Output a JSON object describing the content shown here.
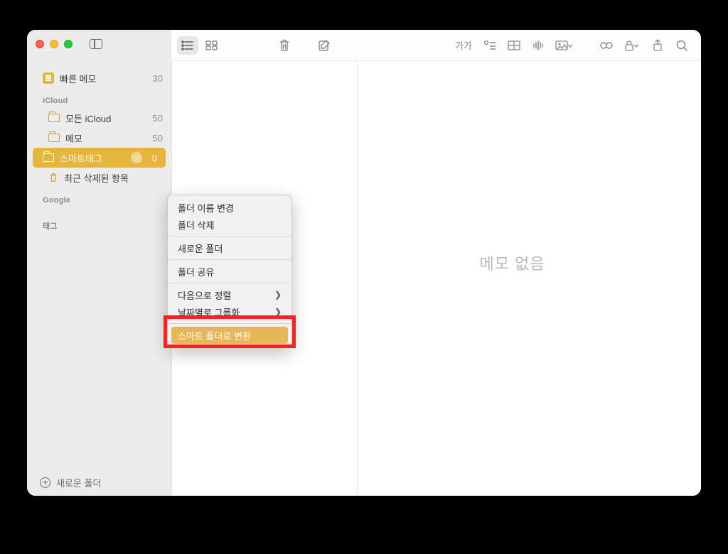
{
  "sidebar": {
    "quick_note": {
      "label": "빠른 메모",
      "count": "30"
    },
    "sections": {
      "icloud": "iCloud",
      "google": "Google",
      "tags": "태그"
    },
    "items": {
      "all_icloud": {
        "label": "모든 iCloud",
        "count": "50"
      },
      "notes": {
        "label": "메모",
        "count": "50"
      },
      "smart_tag": {
        "label": "스마트태그",
        "count": "0"
      },
      "recently_deleted": {
        "label": "최근 삭제된 항목"
      }
    },
    "footer": "새로운 폴더"
  },
  "toolbar": {
    "font_label": "가가"
  },
  "detail": {
    "empty": "메모 없음"
  },
  "context_menu": {
    "rename": "폴더 이름 변경",
    "delete": "폴더 삭제",
    "new_folder": "새로운 폴더",
    "share": "폴더 공유",
    "sort_by": "다음으로 정렬",
    "group_by_date": "날짜별로 그룹화",
    "convert_smart": "스마트 폴더로 변환"
  }
}
